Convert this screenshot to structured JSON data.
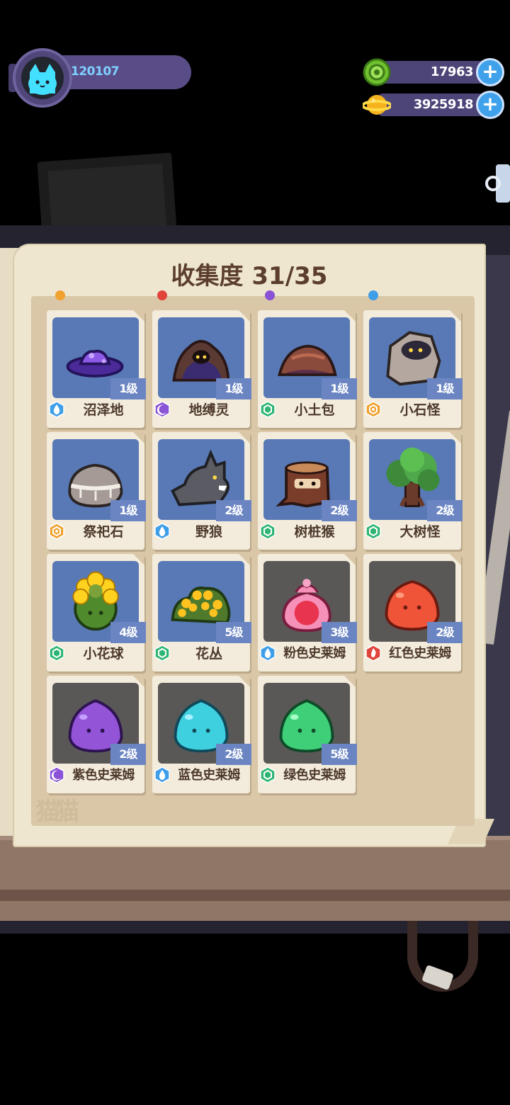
{
  "player": {
    "id": "120107",
    "avatar": "cat-face-icon"
  },
  "resources": {
    "gem": {
      "value": "17963",
      "icon": "green-gem-coin-icon",
      "plus": "+"
    },
    "gold": {
      "value": "3925918",
      "icon": "gold-planet-coin-icon",
      "plus": "+"
    }
  },
  "book": {
    "title": "收集度 31/35",
    "watermark": "猫猫"
  },
  "colors": {
    "water": "#3f9ee8",
    "shadow": "#8a52d6",
    "nature": "#2fb573",
    "earth": "#f0a22e",
    "fire": "#e0443a",
    "card_frame_blue": "#5879b5",
    "card_frame_dark": "#5a5856"
  },
  "monsters": [
    {
      "name": "沼泽地",
      "level": "1级",
      "element": "water",
      "elem_icon": "water-drop-icon",
      "art": "swamp-puddle-icon",
      "frame": "blue"
    },
    {
      "name": "地缚灵",
      "level": "1级",
      "element": "shadow",
      "elem_icon": "crescent-moon-icon",
      "art": "earth-spirit-icon",
      "frame": "blue"
    },
    {
      "name": "小土包",
      "level": "1级",
      "element": "nature",
      "elem_icon": "leaf-hexagon-icon",
      "art": "dirt-mound-icon",
      "frame": "blue"
    },
    {
      "name": "小石怪",
      "level": "1级",
      "element": "earth",
      "elem_icon": "earth-hexagon-icon",
      "art": "rock-golem-icon",
      "frame": "blue"
    },
    {
      "name": "祭祀石",
      "level": "1级",
      "element": "earth",
      "elem_icon": "earth-hexagon-icon",
      "art": "ritual-stone-icon",
      "frame": "blue"
    },
    {
      "name": "野狼",
      "level": "2级",
      "element": "water",
      "elem_icon": "water-drop-icon",
      "art": "wild-wolf-icon",
      "frame": "blue"
    },
    {
      "name": "树桩猴",
      "level": "2级",
      "element": "nature",
      "elem_icon": "leaf-hexagon-icon",
      "art": "stump-monkey-icon",
      "frame": "blue"
    },
    {
      "name": "大树怪",
      "level": "2级",
      "element": "nature",
      "elem_icon": "leaf-hexagon-icon",
      "art": "big-tree-icon",
      "frame": "blue"
    },
    {
      "name": "小花球",
      "level": "4级",
      "element": "nature",
      "elem_icon": "leaf-hexagon-icon",
      "art": "flower-ball-icon",
      "frame": "blue"
    },
    {
      "name": "花丛",
      "level": "5级",
      "element": "nature",
      "elem_icon": "leaf-hexagon-icon",
      "art": "flower-bush-icon",
      "frame": "blue"
    },
    {
      "name": "粉色史莱姆",
      "level": "3级",
      "element": "water",
      "elem_icon": "water-drop-icon",
      "art": "pink-slime-icon",
      "frame": "dark"
    },
    {
      "name": "红色史莱姆",
      "level": "2级",
      "element": "fire",
      "elem_icon": "fire-hexagon-icon",
      "art": "red-slime-icon",
      "frame": "dark"
    },
    {
      "name": "紫色史莱姆",
      "level": "2级",
      "element": "shadow",
      "elem_icon": "crescent-moon-icon",
      "art": "purple-slime-icon",
      "frame": "dark"
    },
    {
      "name": "蓝色史莱姆",
      "level": "2级",
      "element": "water",
      "elem_icon": "water-drop-icon",
      "art": "blue-slime-icon",
      "frame": "dark"
    },
    {
      "name": "绿色史莱姆",
      "level": "5级",
      "element": "nature",
      "elem_icon": "leaf-hexagon-icon",
      "art": "green-slime-icon",
      "frame": "dark"
    }
  ]
}
